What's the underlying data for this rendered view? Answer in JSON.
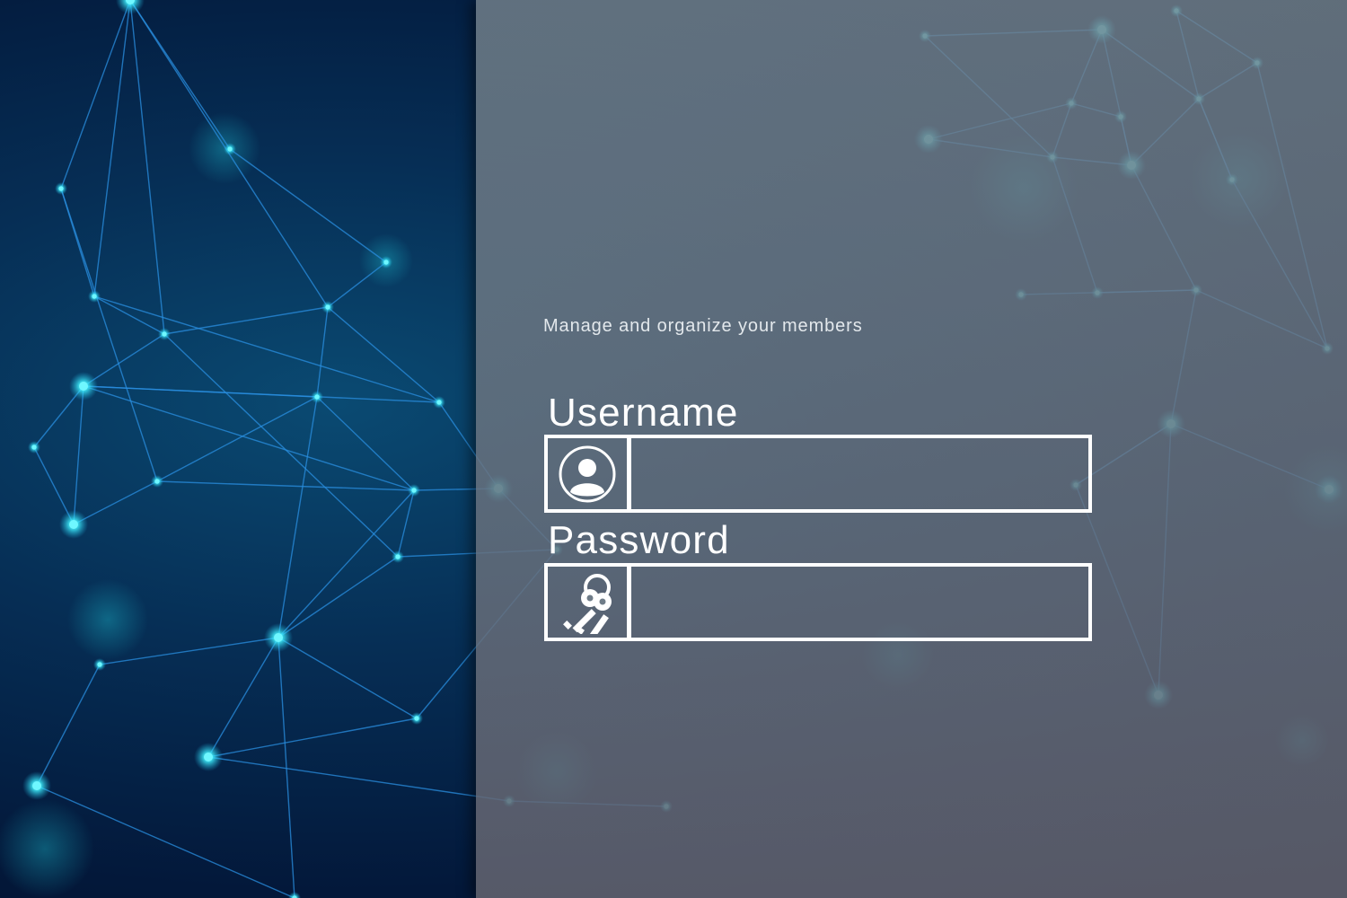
{
  "tagline": "Manage and organize your members",
  "login_form": {
    "username": {
      "label": "Username",
      "value": "",
      "icon": "user-circle-icon"
    },
    "password": {
      "label": "Password",
      "value": "",
      "icon": "keys-icon"
    }
  },
  "colors": {
    "background_dark": "#031a33",
    "network_line": "#2a8fe0",
    "network_node": "#4ff3ff",
    "panel_overlay": "#6f7c88",
    "text": "#ffffff"
  }
}
